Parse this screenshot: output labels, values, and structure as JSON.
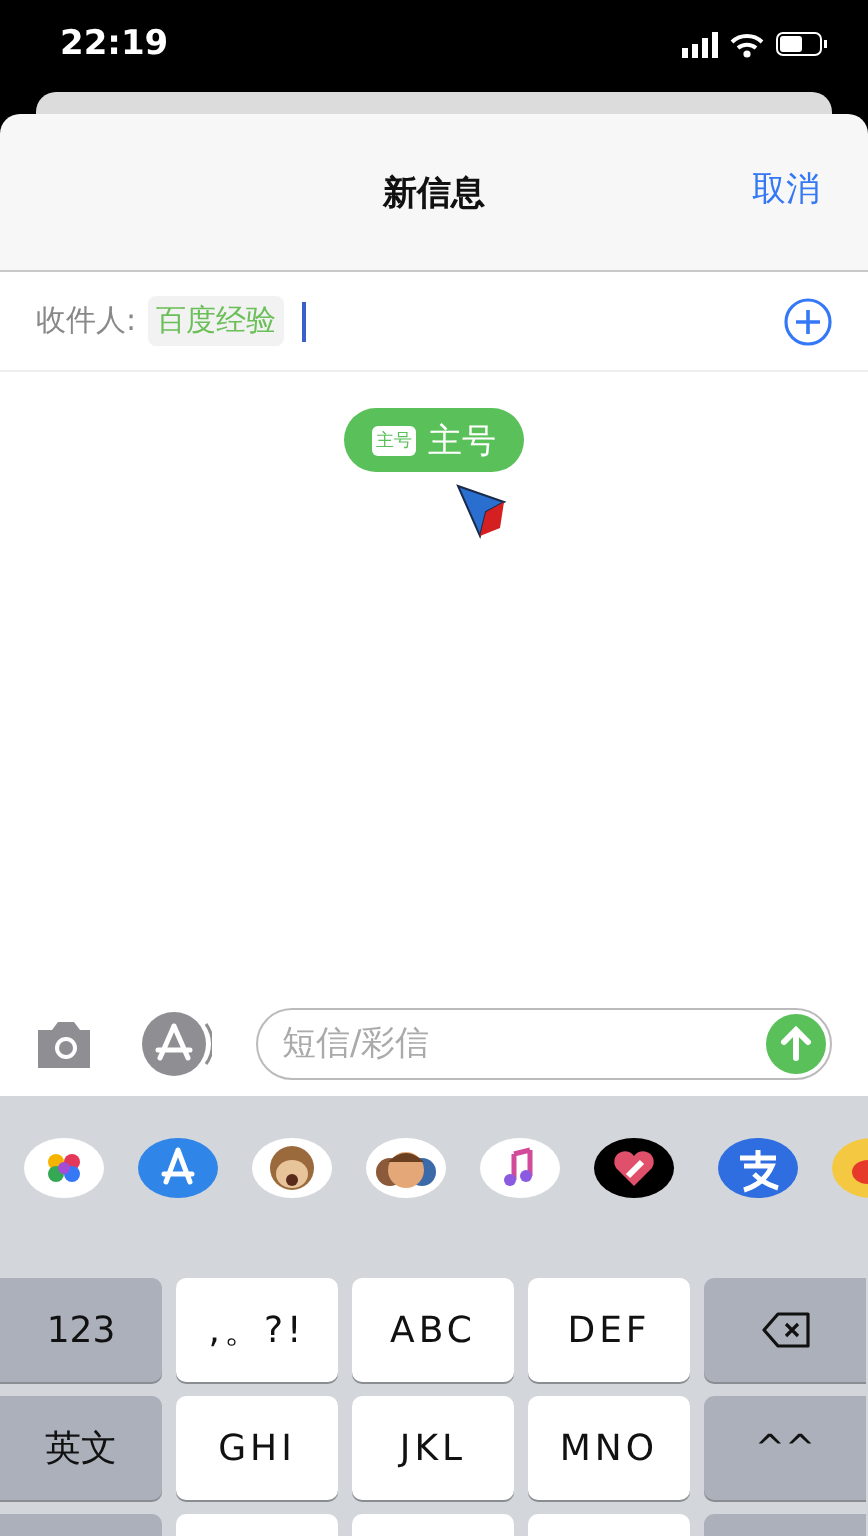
{
  "status_bar": {
    "time": "22:19"
  },
  "header": {
    "title": "新信息",
    "cancel": "取消"
  },
  "recipient": {
    "label": "收件人:",
    "chips": [
      {
        "text": "百度经验"
      }
    ]
  },
  "sim_tag": {
    "badge": "主号",
    "label": "主号"
  },
  "composer": {
    "placeholder": "短信/彩信"
  },
  "keyboard": {
    "rows": [
      [
        {
          "kind": "function",
          "label": "123"
        },
        {
          "kind": "letter",
          "label": ",。?!"
        },
        {
          "kind": "letter",
          "label": "ABC"
        },
        {
          "kind": "letter",
          "label": "DEF"
        },
        {
          "kind": "delete"
        }
      ],
      [
        {
          "kind": "function",
          "label": "英文"
        },
        {
          "kind": "letter",
          "label": "GHI"
        },
        {
          "kind": "letter",
          "label": "JKL"
        },
        {
          "kind": "letter",
          "label": "MNO"
        },
        {
          "kind": "function",
          "label": "^^"
        }
      ],
      [
        {
          "kind": "function"
        },
        {
          "kind": "letter"
        },
        {
          "kind": "letter"
        },
        {
          "kind": "letter"
        },
        {
          "kind": "function"
        }
      ]
    ]
  }
}
